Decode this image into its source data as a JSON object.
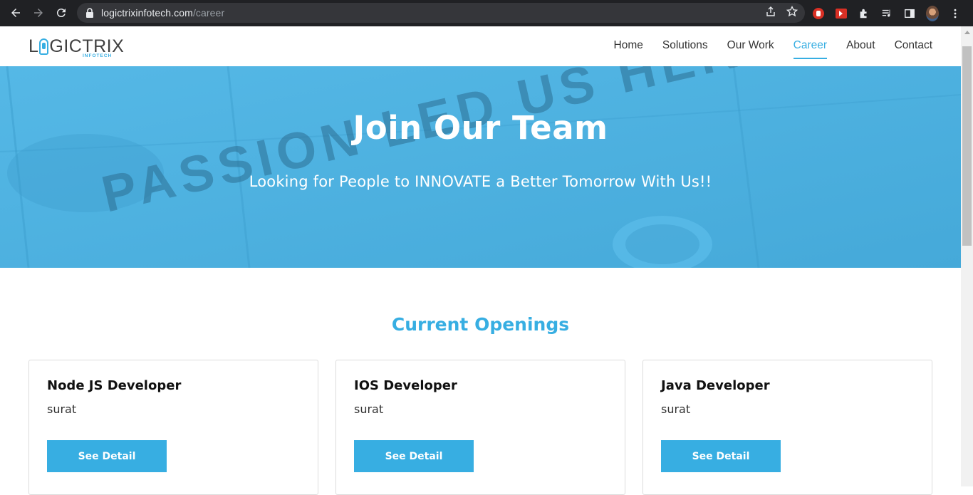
{
  "browser": {
    "url_domain": "logictrixinfotech.com",
    "url_path": "/career"
  },
  "site": {
    "logo_pre": "L",
    "logo_post": "GICTRIX",
    "logo_sub": "INFOTECH",
    "nav": [
      {
        "label": "Home",
        "active": false
      },
      {
        "label": "Solutions",
        "active": false
      },
      {
        "label": "Our Work",
        "active": false
      },
      {
        "label": "Career",
        "active": true
      },
      {
        "label": "About",
        "active": false
      },
      {
        "label": "Contact",
        "active": false
      }
    ]
  },
  "hero": {
    "title": "Join Our Team",
    "subtitle": "Looking for People to INNOVATE a Better Tomorrow With Us!!",
    "bg_text": "PASSION LED US HERE"
  },
  "openings": {
    "title": "Current Openings",
    "jobs": [
      {
        "title": "Node JS Developer",
        "location": "surat",
        "button": "See Detail"
      },
      {
        "title": "IOS Developer",
        "location": "surat",
        "button": "See Detail"
      },
      {
        "title": "Java Developer",
        "location": "surat",
        "button": "See Detail"
      }
    ]
  },
  "colors": {
    "accent": "#37aee2",
    "hero_bg": "#4fb3e2",
    "chrome_bg": "#202124"
  }
}
